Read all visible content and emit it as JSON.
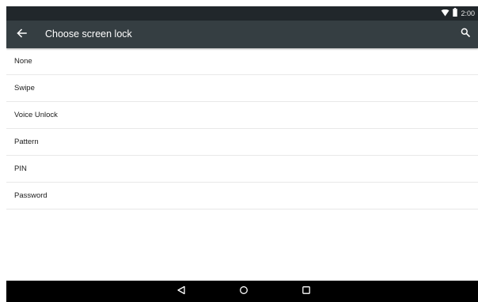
{
  "status_bar": {
    "time": "2:00",
    "icons": [
      "wifi-icon",
      "battery-icon"
    ]
  },
  "toolbar": {
    "title": "Choose screen lock",
    "back_icon": "arrow-left-icon",
    "search_icon": "search-icon"
  },
  "options": [
    {
      "label": "None"
    },
    {
      "label": "Swipe"
    },
    {
      "label": "Voice Unlock"
    },
    {
      "label": "Pattern"
    },
    {
      "label": "PIN"
    },
    {
      "label": "Password"
    }
  ],
  "nav_bar": {
    "buttons": [
      "back-triangle-icon",
      "home-circle-icon",
      "recents-square-icon"
    ]
  },
  "colors": {
    "status_bar": "#21272b",
    "toolbar": "#353e42",
    "background": "#ffffff",
    "nav_bar": "#000000",
    "divider": "#e8e8e8"
  }
}
